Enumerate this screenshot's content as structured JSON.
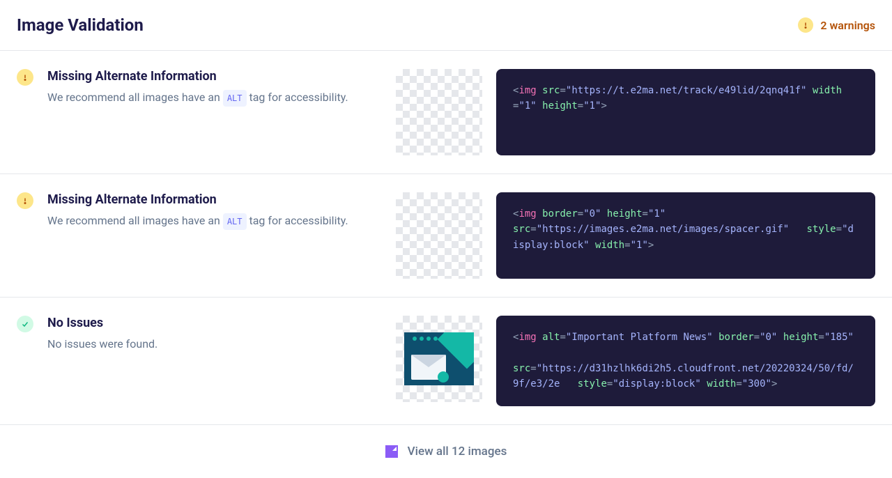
{
  "header": {
    "title": "Image Validation",
    "warnings_label": "2 warnings"
  },
  "rows": [
    {
      "status": "warning",
      "title": "Missing Alternate Information",
      "desc_before": "We recommend all images have an ",
      "alt_tag": "ALT",
      "desc_after": " tag for accessibility.",
      "thumb_type": "empty",
      "code": {
        "tag": "img",
        "attrs": [
          {
            "name": "src",
            "value": "\"https://t.e2ma.net/track/e49lid/2qnq41f\""
          },
          {
            "name": "width",
            "value": "\"1\""
          },
          {
            "name": "height",
            "value": "\"1\""
          }
        ]
      }
    },
    {
      "status": "warning",
      "title": "Missing Alternate Information",
      "desc_before": "We recommend all images have an ",
      "alt_tag": "ALT",
      "desc_after": " tag for accessibility.",
      "thumb_type": "empty",
      "code": {
        "tag": "img",
        "attrs": [
          {
            "name": "border",
            "value": "\"0\""
          },
          {
            "name": "height",
            "value": "\"1\""
          },
          {
            "name": "src",
            "value": "\"https://images.e2ma.net/images/spacer.gif\"",
            "break_before": true
          },
          {
            "name": "style",
            "value": "\"display:block\"",
            "indent": true
          },
          {
            "name": "width",
            "value": "\"1\""
          }
        ]
      }
    },
    {
      "status": "success",
      "title": "No Issues",
      "desc_before": "No issues were found.",
      "alt_tag": "",
      "desc_after": "",
      "thumb_type": "image",
      "code": {
        "tag": "img",
        "attrs": [
          {
            "name": "alt",
            "value": "\"Important Platform News\""
          },
          {
            "name": "border",
            "value": "\"0\""
          },
          {
            "name": "height",
            "value": "\"185\""
          },
          {
            "name": "src",
            "value": "\"https://d31hzlhk6di2h5.cloudfront.net/20220324/50/fd/9f/e3/2e",
            "break_before": true,
            "blank_before": true
          },
          {
            "name": "style",
            "value": "\"display:block\"",
            "indent": true
          },
          {
            "name": "width",
            "value": "\"300\""
          }
        ]
      }
    }
  ],
  "footer": {
    "view_all": "View all 12 images"
  }
}
